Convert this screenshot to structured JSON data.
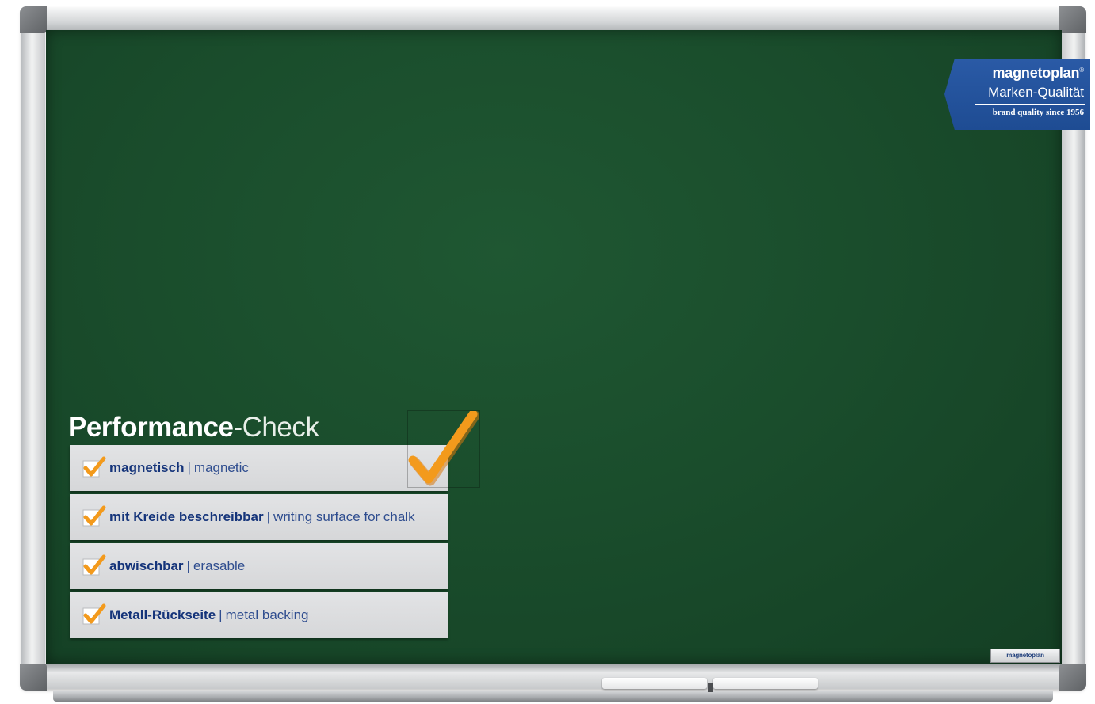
{
  "brand_badge": {
    "name": "magnetoplan",
    "registered": "®",
    "tagline": "Marken-Qualität",
    "since": "brand quality since 1956"
  },
  "performance_check": {
    "title_bold": "Performance",
    "title_light": "-Check",
    "separator": "|",
    "items": [
      {
        "label_de": "magnetisch",
        "label_en": "magnetic"
      },
      {
        "label_de": "mit Kreide beschreibbar",
        "label_en": "writing surface for chalk"
      },
      {
        "label_de": "abwischbar",
        "label_en": "erasable"
      },
      {
        "label_de": "Metall-Rückseite",
        "label_en": "metal backing"
      }
    ]
  },
  "board": {
    "surface_color": "#1a4d2c",
    "frame_brand": "magnetoplan"
  },
  "colors": {
    "check_orange": "#f39a1c",
    "brand_blue": "#1e4c93",
    "text_blue": "#15347a"
  },
  "icons": {
    "check": "checkmark-icon"
  }
}
